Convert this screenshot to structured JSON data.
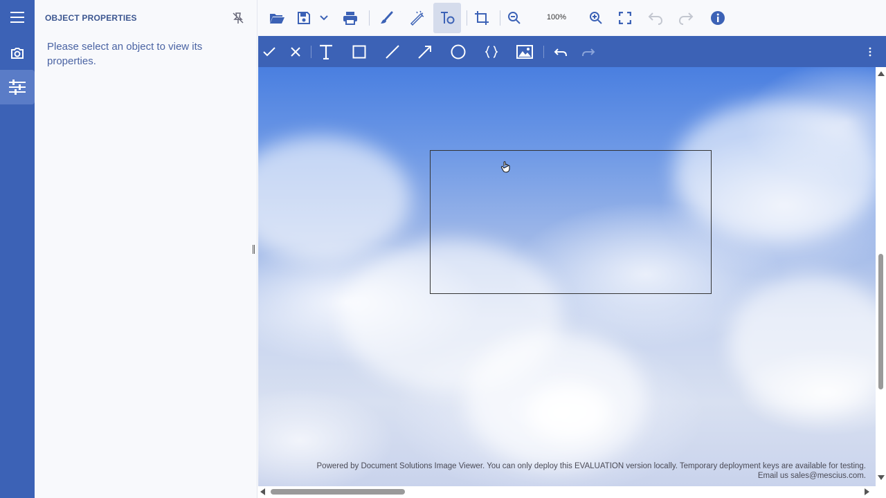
{
  "rail": {
    "items": [
      {
        "name": "menu-icon"
      },
      {
        "name": "camera-icon"
      },
      {
        "name": "properties-icon"
      }
    ]
  },
  "panel": {
    "title": "OBJECT PROPERTIES",
    "message": "Please select an object to view its properties."
  },
  "toolbar": {
    "zoom": "100%",
    "icons": [
      "open-icon",
      "save-icon",
      "save-dropdown-icon",
      "print-icon",
      "paint-icon",
      "effects-icon",
      "text-object-icon",
      "crop-icon",
      "zoom-out-icon",
      "zoom-in-icon",
      "fullscreen-icon",
      "undo-icon",
      "redo-icon",
      "info-icon"
    ]
  },
  "subtoolbar": {
    "icons": [
      "apply-icon",
      "cancel-icon",
      "text-tool-icon",
      "rectangle-tool-icon",
      "line-tool-icon",
      "arrow-tool-icon",
      "ellipse-tool-icon",
      "brackets-tool-icon",
      "image-tool-icon",
      "undo-icon",
      "redo-icon",
      "more-icon"
    ]
  },
  "watermark": {
    "line1": "Powered by Document Solutions Image Viewer. You can only deploy this EVALUATION version locally. Temporary deployment keys are available for testing.",
    "line2": "Email us sales@mescius.com."
  },
  "colors": {
    "brand": "#3c62b6",
    "panel_bg": "#f8f9fc",
    "panel_text": "#4a63a3"
  }
}
